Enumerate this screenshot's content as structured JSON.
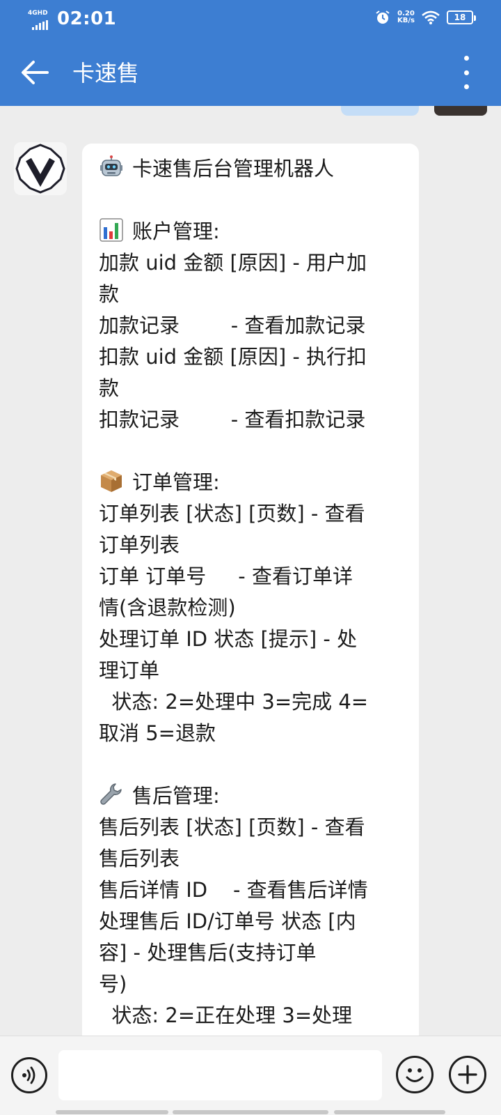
{
  "status_bar": {
    "time": "02:01",
    "network": "4GHD",
    "speed_value": "0.20",
    "speed_unit": "KB/s",
    "battery": "18"
  },
  "header": {
    "title": "卡速售",
    "back_icon": "arrow-left-icon",
    "menu_icon": "more-vertical-icon",
    "background_color": "#3d7ed2"
  },
  "chat": {
    "bot_avatar_icon": "v-logo-icon",
    "message_lines": [
      {
        "icon": "robot-icon",
        "text": "卡速售后台管理机器人"
      },
      {
        "text": ""
      },
      {
        "icon": "bar-chart-icon",
        "text": "账户管理:"
      },
      {
        "text": "加款 uid 金额 [原因] - 用户加"
      },
      {
        "text": "款"
      },
      {
        "text": "加款记录        - 查看加款记录"
      },
      {
        "text": "扣款 uid 金额 [原因] - 执行扣"
      },
      {
        "text": "款"
      },
      {
        "text": "扣款记录        - 查看扣款记录"
      },
      {
        "text": ""
      },
      {
        "icon": "package-icon",
        "text": "订单管理:"
      },
      {
        "text": "订单列表 [状态] [页数] - 查看"
      },
      {
        "text": "订单列表"
      },
      {
        "text": "订单 订单号     - 查看订单详"
      },
      {
        "text": "情(含退款检测)"
      },
      {
        "text": "处理订单 ID 状态 [提示] - 处"
      },
      {
        "text": "理订单"
      },
      {
        "text": "  状态: 2=处理中 3=完成 4="
      },
      {
        "text": "取消 5=退款"
      },
      {
        "text": ""
      },
      {
        "icon": "wrench-icon",
        "text": "售后管理:"
      },
      {
        "text": "售后列表 [状态] [页数] - 查看"
      },
      {
        "text": "售后列表"
      },
      {
        "text": "售后详情 ID    - 查看售后详情"
      },
      {
        "text": "处理售后 ID/订单号 状态 [内"
      },
      {
        "text": "容] - 处理售后(支持订单"
      },
      {
        "text": "号)"
      },
      {
        "text": "  状态: 2=正在处理 3=处理"
      }
    ]
  },
  "input_bar": {
    "voice_icon": "voice-icon",
    "emoji_icon": "smiley-icon",
    "plus_icon": "plus-icon",
    "input_value": ""
  }
}
